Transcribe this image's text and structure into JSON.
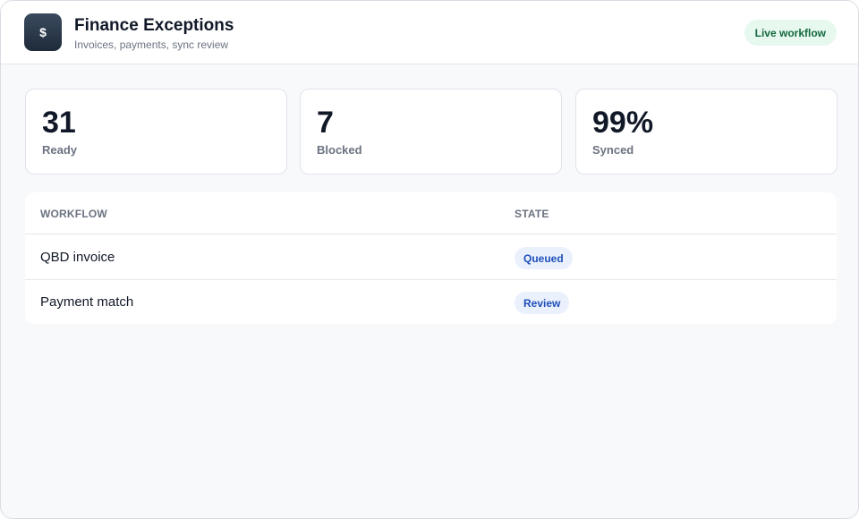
{
  "header": {
    "icon_glyph": "$",
    "icon_name": "dollar-icon",
    "title": "Finance Exceptions",
    "subtitle": "Invoices, payments, sync review",
    "status_badge": "Live workflow"
  },
  "stats": [
    {
      "value": "31",
      "label": "Ready"
    },
    {
      "value": "7",
      "label": "Blocked"
    },
    {
      "value": "99%",
      "label": "Synced"
    }
  ],
  "table": {
    "columns": [
      "WORKFLOW",
      "STATE"
    ],
    "rows": [
      {
        "workflow": "QBD invoice",
        "state": "Queued"
      },
      {
        "workflow": "Payment match",
        "state": "Review"
      }
    ]
  },
  "colors": {
    "live_badge_bg": "#e7f8ef",
    "live_badge_text": "#14683e",
    "state_pill_bg": "#eaf1fd",
    "state_pill_text": "#1e4fb8",
    "app_icon_bg": "#2b394a"
  }
}
